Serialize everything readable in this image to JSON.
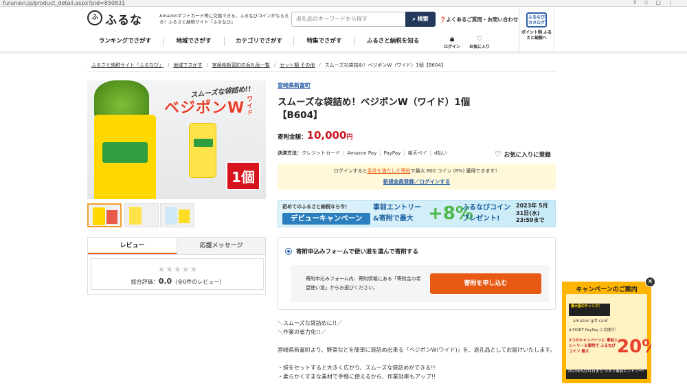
{
  "browser": {
    "url": "furunavi.jp/product_detail.aspx?pid=850831",
    "icons": [
      "share-icon",
      "bookmark-icon",
      "extensions-icon",
      "menu-icon"
    ]
  },
  "header": {
    "logo_mark": "ふ",
    "logo_text": "ふるなび",
    "tagline": "Amazonギフトカード等に交換できる、ふるなびコインがもらえる！ふるさと納税サイト「ふるなび」",
    "search_placeholder": "返礼品のキーワードから探す",
    "search_button": "検索",
    "faq": "よくあるご質問・お問い合わせ",
    "catalog_icon": "ふるなび カタログ",
    "catalog_label": "ポイント制 ふるさと納税へ"
  },
  "nav": {
    "items": [
      "ランキングでさがす",
      "地域でさがす",
      "カテゴリでさがす",
      "特集でさがす",
      "ふるさと納税を知る"
    ],
    "login": "ログイン",
    "favorites": "お気に入り"
  },
  "breadcrumb": [
    "ふるさと納税サイト「ふるなび」",
    "地域でさがす",
    "宮崎県新富町の返礼品一覧",
    "セット類 その他",
    "スムーズな袋詰め！ベジポンW（ワイド）1個【B604】"
  ],
  "product": {
    "image": {
      "bubble": "スムーズな袋詰め!!",
      "title": "ベジポンW",
      "subtitle": "ワイド",
      "count": "1個"
    },
    "area": "宮崎県新富町",
    "title": "スムーズな袋詰め！ベジポンW（ワイド）1個【B604】",
    "price_label": "寄附金額：",
    "price_value": "10,000",
    "price_unit": "円",
    "payment_label": "決済方法：",
    "payment_methods": [
      "クレジットカード",
      "Amazon Pay",
      "PayPay",
      "楽天ペイ",
      "d払い"
    ],
    "favorite": "お気に入りに登録"
  },
  "coin": {
    "line_pre": "ログインすると",
    "line_link": "条件を満たした寄附",
    "line_post": "で最大 800 コイン (8%) 獲得できます！",
    "register": "新規会員登録／ログインする"
  },
  "banner": {
    "a": "初めてのふるさと納税なら今！",
    "b": "デビューキャンペーン",
    "c": "事前エントリー &寄附で最大",
    "pct": "+8%",
    "d": "ふるなびコイン プレゼント!",
    "e": "2023年 5月31日(水) 23:59まで"
  },
  "reviews": {
    "tab_reviews": "レビュー",
    "tab_messages": "応援メッセージ",
    "stars": "★★★★★",
    "rating_label": "総合評価：",
    "rating_value": "0.0",
    "rating_count": "（全0件のレビュー）"
  },
  "form": {
    "option": "寄附申込みフォームで使い道を選んで寄附する",
    "desc": "寄附申込みフォーム内、寄附情報にある「寄附金の希望使い道」からお選びください。",
    "submit": "寄附を申し込む"
  },
  "description": "＼スムーズな袋詰めに!!／\n＼作業の省力化!!／\n\n宮崎県新富町より、野菜などを簡単に袋詰め出来る「ベジポンW(ワイド)」を、返礼品としてお届けいたします。\n\n・袋をセットすると大きく広がり、スムーズな袋詰めができる!!\n・柔らかくすまな素材で手軽に使えるから、作業効率もアップ!!",
  "popup": {
    "title": "キャンペーンのご案内",
    "a": "最大級のチャンス！",
    "b": "amazon gift card",
    "c": "d POINT  PayPay に交換可！",
    "d": "2つのキャンペーンに 事前エントリー＆寄附で ふるなびコイン 最大",
    "pct": "20%",
    "f": "2023年5月31日まで 今すぐ事前エントリー！",
    "close": "×"
  },
  "colors": {
    "accent": "#e85a14",
    "price": "#c8161d",
    "link": "#2a5fa8",
    "search_button": "#23395b",
    "popup": "#ffb400"
  }
}
